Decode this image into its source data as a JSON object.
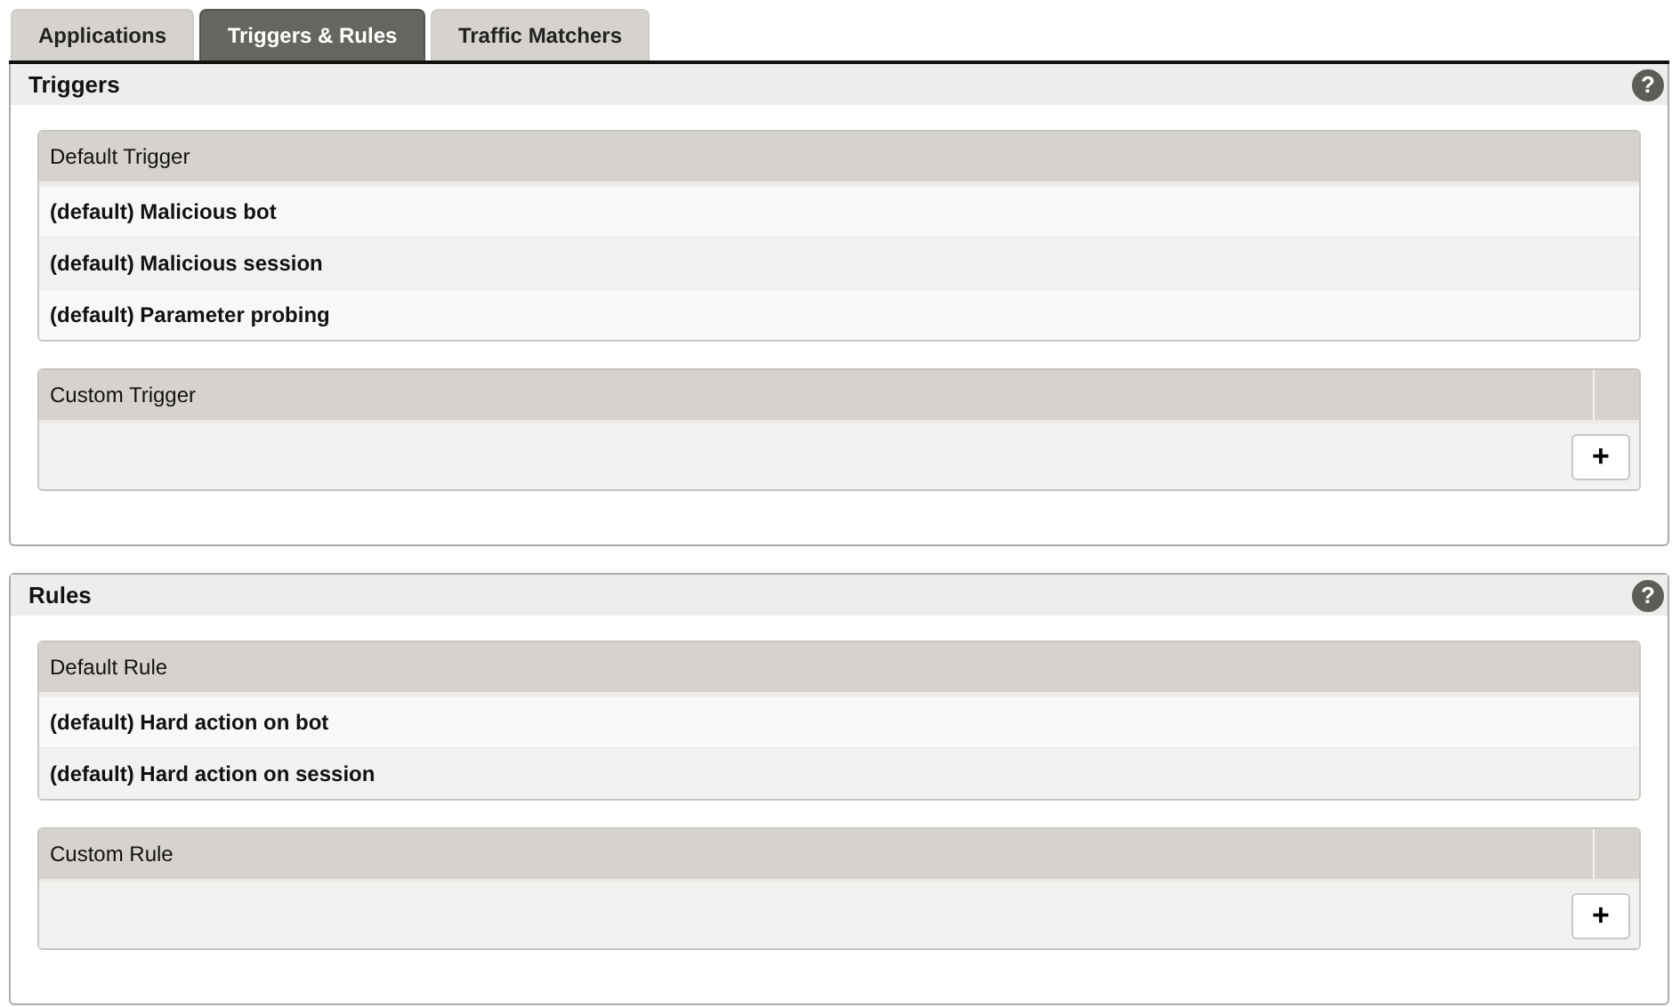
{
  "tabs": [
    {
      "label": "Applications",
      "selected": false
    },
    {
      "label": "Triggers & Rules",
      "selected": true
    },
    {
      "label": "Traffic Matchers",
      "selected": false
    }
  ],
  "panels": [
    {
      "title": "Triggers",
      "help": "?",
      "default_table": {
        "heading": "Default Trigger",
        "rows": [
          "(default) Malicious bot",
          "(default) Malicious session",
          "(default) Parameter probing"
        ]
      },
      "custom_table": {
        "heading": "Custom Trigger",
        "add": "+"
      }
    },
    {
      "title": "Rules",
      "help": "?",
      "default_table": {
        "heading": "Default Rule",
        "rows": [
          "(default) Hard action on bot",
          "(default) Hard action on session"
        ]
      },
      "custom_table": {
        "heading": "Custom Rule",
        "add": "+"
      }
    }
  ]
}
